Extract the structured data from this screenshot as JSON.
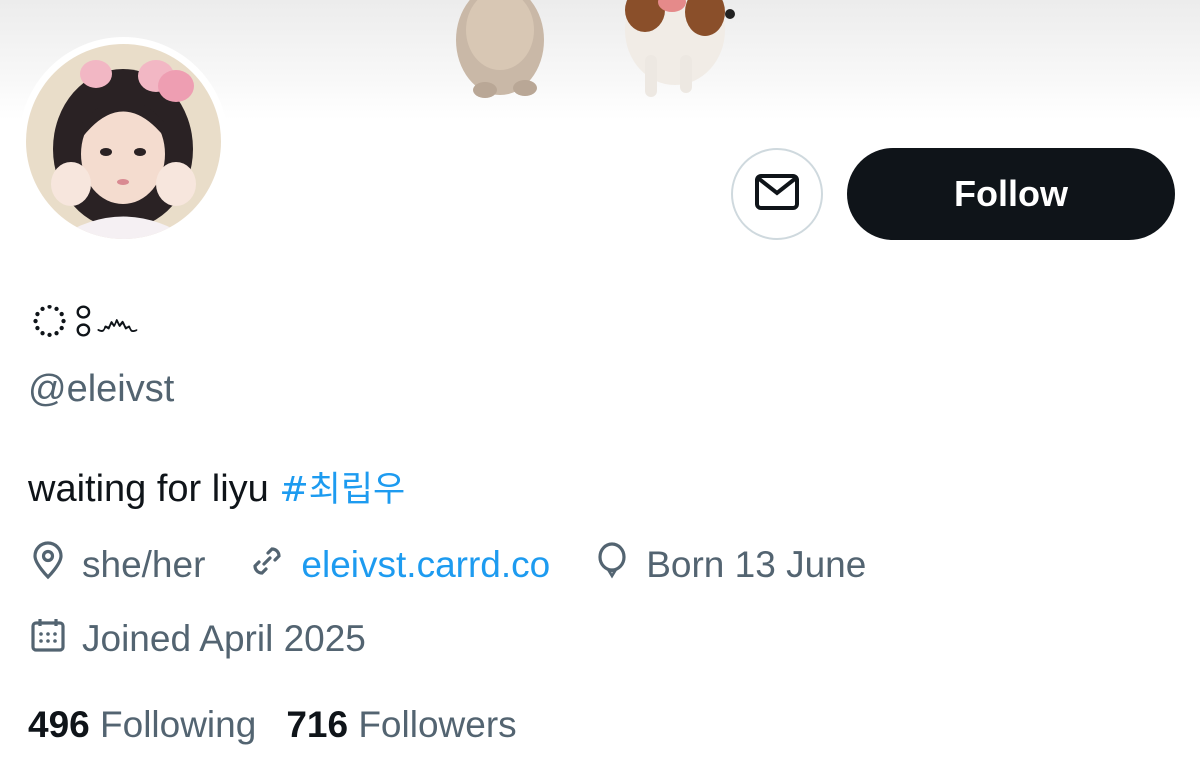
{
  "profile": {
    "display_name": "ঃ෴",
    "handle": "@eleivst",
    "bio_text": "waiting for liyu ",
    "bio_hashtag": "#최립우",
    "pronouns": "she/her",
    "website": "eleivst.carrd.co",
    "birthday": "Born 13 June",
    "joined": "Joined April 2025"
  },
  "actions": {
    "follow_label": "Follow"
  },
  "stats": {
    "following_count": "496",
    "following_label": "Following",
    "followers_count": "716",
    "followers_label": "Followers"
  },
  "icons": {
    "message": "envelope-icon",
    "location": "location-pin-icon",
    "link": "link-icon",
    "birthday": "balloon-icon",
    "joined": "calendar-icon"
  },
  "colors": {
    "accent": "#1d9bf0",
    "primary_text": "#0f1419",
    "secondary_text": "#536471",
    "follow_bg": "#0f1419"
  }
}
